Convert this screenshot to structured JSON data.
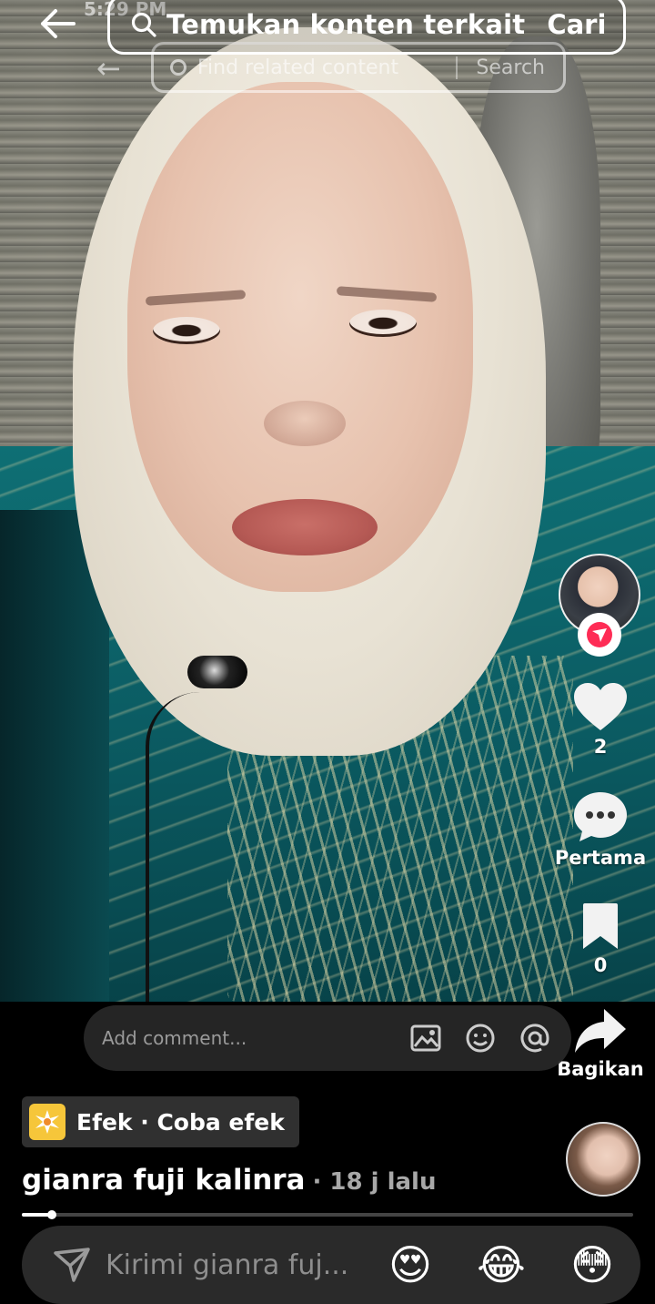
{
  "ghost": {
    "status_time": "5:29 PM",
    "search_placeholder": "Find related content",
    "search_button": "Search"
  },
  "top_bar": {
    "search_placeholder": "Temukan konten terkait",
    "search_button": "Cari"
  },
  "rail": {
    "like_count": "2",
    "comment_label": "Pertama",
    "favorite_count": "0",
    "share_label": "Bagikan"
  },
  "comment_bar": {
    "placeholder": "Add comment..."
  },
  "video_info": {
    "effect_label": "Efek · Coba efek",
    "username": "gianra fuji kalinra",
    "timestamp": "· 18 j lalu",
    "progress": 0.05
  },
  "reply_bar": {
    "placeholder": "Kirimi gianra fuj...",
    "emojis": [
      "😍",
      "😂",
      "😳"
    ]
  },
  "colors": {
    "accent": "#fe2c55",
    "effect_icon": "#f6c63a"
  }
}
